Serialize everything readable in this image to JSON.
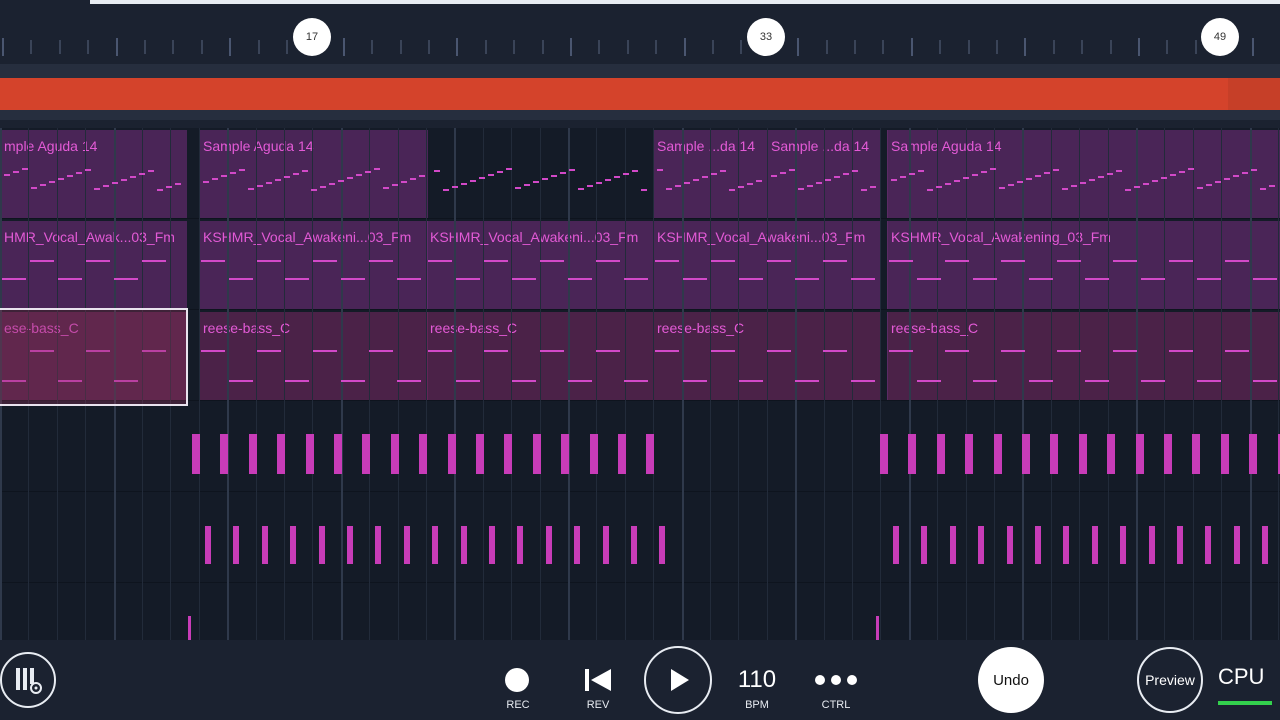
{
  "ruler": {
    "markers": [
      "17",
      "33",
      "49"
    ]
  },
  "tracks": [
    {
      "clips": [
        "mple Aguda 14",
        "Sample Aguda 14",
        "Sample ...da 14",
        "Sample ...da 14",
        "Sample Aguda 14"
      ]
    },
    {
      "clips": [
        "HMR_Vocal_Awak...03_Fm",
        "KSHMR_Vocal_Awakeni...03_Fm",
        "KSHMR_Vocal_Awakeni...03_Fm",
        "KSHMR_Vocal_Awakeni...03_Fm",
        "KSHMR_Vocal_Awakening_03_Fm"
      ]
    },
    {
      "clips": [
        "ese-bass_C",
        "reese-bass_C",
        "reese-bass_C",
        "reese-bass_C",
        "reese-bass_C"
      ]
    }
  ],
  "transport": {
    "rec": "REC",
    "rev": "REV",
    "bpm_value": "110",
    "bpm_label": "BPM",
    "ctrl": "CTRL",
    "undo": "Undo",
    "preview": "Preview",
    "cpu": "CPU"
  },
  "icons": {
    "piano_settings": "piano-settings-icon",
    "record": "record-icon",
    "rewind": "skip-back-icon",
    "play": "play-icon",
    "more": "more-dots-icon"
  },
  "colors": {
    "background": "#1b2230",
    "playhead_bar": "#d4432b",
    "clip_text": "#e35ad6",
    "cpu_ok": "#33d14d"
  }
}
